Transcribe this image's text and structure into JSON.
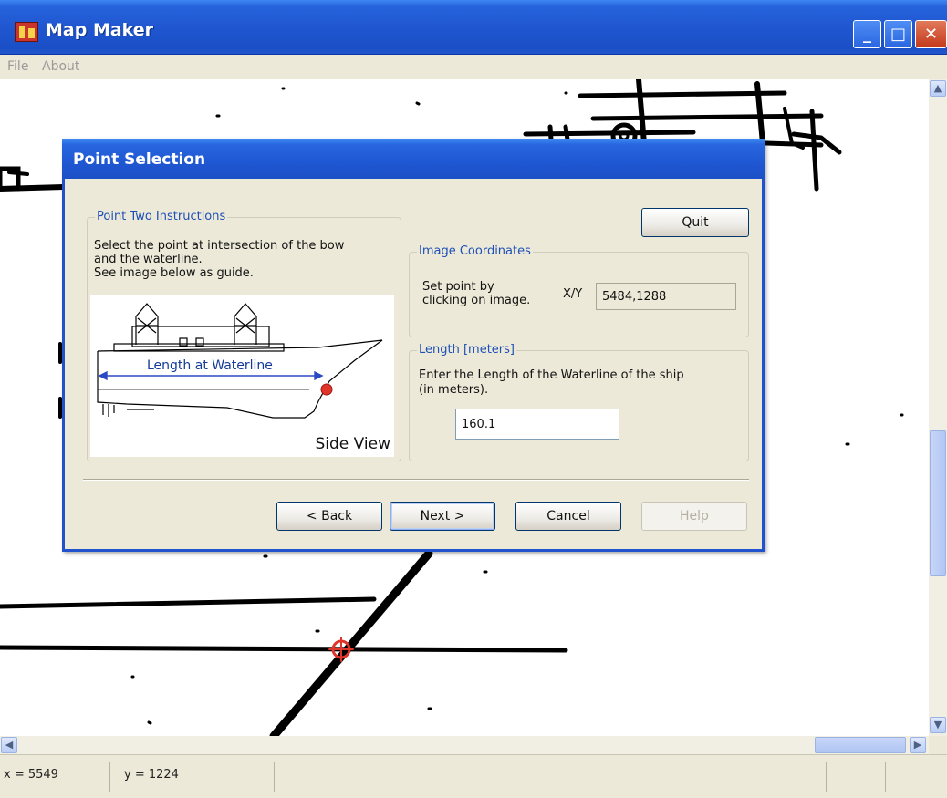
{
  "window": {
    "title": "Map Maker",
    "controls": {
      "minimize": "_",
      "maximize": "□",
      "close": "✕"
    }
  },
  "menu": {
    "items": [
      "File",
      "About"
    ]
  },
  "dialog": {
    "title": "Point Selection",
    "instructions": {
      "group_label": "Point Two Instructions",
      "line1": "Select the point at intersection of the bow",
      "line2": "and the waterline.",
      "line3": "See image below as guide.",
      "diagram_label": "Length at Waterline",
      "caption": "Side View"
    },
    "quit_label": "Quit",
    "coords": {
      "group_label": "Image Coordinates",
      "hint_line1": "Set point by",
      "hint_line2": "clicking on image.",
      "xy_label": "X/Y",
      "xy_value": "5484,1288"
    },
    "length": {
      "group_label": "Length [meters]",
      "prompt_line1": "Enter the Length of the Waterline of the ship",
      "prompt_line2": "(in meters).",
      "value": "160.1"
    },
    "buttons": {
      "back": "< Back",
      "next": "Next >",
      "cancel": "Cancel",
      "help": "Help"
    }
  },
  "status": {
    "x": "x = 5549",
    "y": "y = 1224"
  },
  "colors": {
    "titlebar": "#1f55cf",
    "dialog_border": "#1f52cc",
    "marker": "#e0352a",
    "accent_text": "#1d4fb8"
  }
}
